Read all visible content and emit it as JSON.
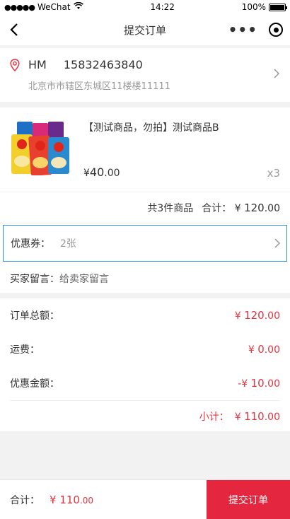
{
  "status_bar": {
    "carrier": "WeChat",
    "time": "14:22",
    "battery": "100%"
  },
  "nav": {
    "title": "提交订单"
  },
  "address": {
    "name": "HM",
    "phone": "15832463840",
    "detail": "北京市市辖区东城区11楼楼11111"
  },
  "product": {
    "title": "【测试商品，勿拍】测试商品B",
    "price_symbol": "¥",
    "price_int": "40",
    "price_dec": ".00",
    "quantity": "x3"
  },
  "summary": {
    "count_text": "共3件商品",
    "total_label": "合计：",
    "total_symbol": "¥",
    "total_int": "120",
    "total_dec": ".00"
  },
  "coupon": {
    "label": "优惠券：",
    "value": "2张"
  },
  "message": {
    "label": "买家留言：",
    "placeholder": "给卖家留言"
  },
  "totals": {
    "order_total_label": "订单总额：",
    "order_total_symbol": "¥",
    "order_total_int": "120",
    "order_total_dec": ".00",
    "shipping_label": "运费：",
    "shipping_symbol": "¥",
    "shipping_int": "0",
    "shipping_dec": ".00",
    "discount_label": "优惠金额：",
    "discount_symbol": "-¥",
    "discount_int": "10",
    "discount_dec": ".00",
    "subtotal_label": "小计：",
    "subtotal_symbol": "¥",
    "subtotal_int": "110",
    "subtotal_dec": ".00"
  },
  "bottom": {
    "total_label": "合计：",
    "total_symbol": "¥",
    "total_int": "110",
    "total_dec": ".00",
    "submit_label": "提交订单"
  },
  "colors": {
    "accent_red": "#e4353f",
    "submit_bg": "#e4273e",
    "coupon_border": "#2b8ed6"
  },
  "icons": [
    "back-arrow-icon",
    "more-dots-icon",
    "target-icon",
    "location-pin-icon",
    "chevron-right-icon"
  ]
}
